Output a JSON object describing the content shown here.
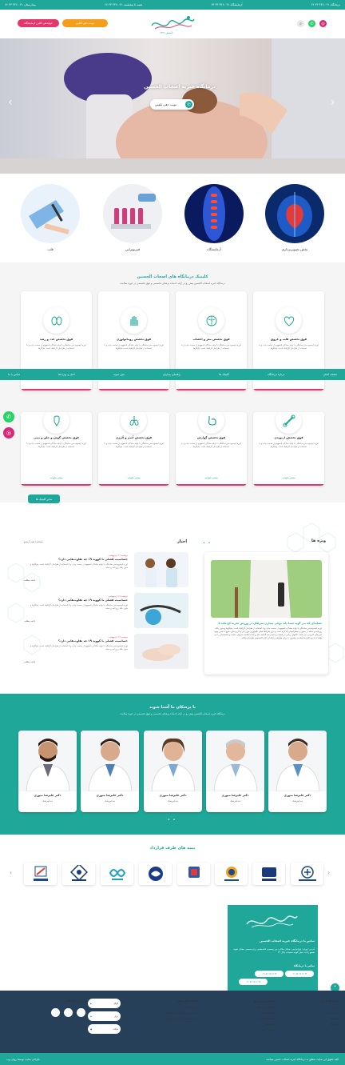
{
  "topbar": {
    "right": "درمانگاه ۰۲۱-۴۴۶ ۲۳ ۶۲",
    "center_right": "آزمایشگاه ۰۲۱-۴۴۶ ۲۳ ۶۳",
    "center_left": "شنبه تا پنجشنبه ۰۲۱-۴۴۶ ۲۳ ۶۶",
    "left": "بیمارستان ۰۲۱-۴۴۶ ۲۳ ۶۶"
  },
  "header": {
    "logo_text": "درمانگاه خیریه اصحاب الحسین",
    "logo_sub": "تأسیس ۱۳۹۱",
    "btn_nobat": "نوبت دهی آنلاین",
    "btn_javab": "جوابدهی آنلاین آزمایشگاه"
  },
  "hero": {
    "title": "درمانگاه خیریه اصحاب الحسین",
    "cta": "نوبت دهی تلفنی"
  },
  "categories": [
    {
      "label": "بخش تصویربرداری"
    },
    {
      "label": "آزمایشگاه"
    },
    {
      "label": "فیزیوتراپی"
    },
    {
      "label": "قلب"
    }
  ],
  "clinics": {
    "title": "کلینیک درمانگاه های اصحاب الحسین",
    "subtitle": "درمانگاه خیریه اصحاب الحسین پیش رو در ارائه خدمات پزشکی تخصصی و فوق تخصصی در حوزه سلامت",
    "desc": "لورم ایپسوم متن ساختگی با تولید سادگی نامفهوم از صنعت چاپ و با استفاده از طراحان گرافیک است. چاپگرها",
    "more": "بیشتر بخوانید",
    "all_button": "سایر کلینیک ها",
    "cards": [
      {
        "title": "فوق تخصص قلب و عروق"
      },
      {
        "title": "فوق تخصص مغز و اعصاب"
      },
      {
        "title": "فوق تخصص روماتولوژی"
      },
      {
        "title": "فوق تخصص غدد و رشد"
      },
      {
        "title": "فوق تخصص ارتوپدی"
      },
      {
        "title": "فوق تخصص گوارش"
      },
      {
        "title": "فوق تخصص آسم و آلرژی"
      },
      {
        "title": "فوق تخصص گوش و حلق و بینی"
      }
    ]
  },
  "nav": {
    "items": [
      "صفحه اصلی",
      "درباره درمانگاه",
      "کلینیک ها",
      "راهنمای بیماران",
      "متن نمونه",
      "اخبار و ویژه ها",
      "تماس با ما"
    ]
  },
  "specials": {
    "title": "ویژه ها",
    "item_title": "۵ نشانه‌ای که می گوید شما باید نوعی بیماری سرطان در ورزش تجربه کرده‌اید",
    "item_desc": "لورم ایپسوم متن ساختگی با تولید سادگی نامفهوم از صنعت چاپ و با استفاده از طراحان گرافیک است. چاپگرها و متون بلکه روزنامه و مجله در ستون و سطرآنچنان که لازم است و برای شرایط فعلی تکنولوژی مورد نیاز و کاربردهای متنوع با هدف بهبود ابزارهای کاربردی می باشد. کتابهای زیادی در شصت و سه درصد گذشته حال و آینده شناخت فراوان جامعه و متخصصان را می طلبد تا با نرم افزارها شناخت بیشتری را برای طراحان رایانه ای علی الخصوص طراحان خلاقی"
  },
  "news": {
    "title": "اخبار",
    "see_all": "مشاهده همه آرشیو",
    "more": "ادامه مطلب",
    "items": [
      {
        "date": "دوشنبه ۱۲ اردیبهشت",
        "title": "حساسیت فصلی با کووید ۱۹ چه تفاوت‌هایی دارد؟",
        "desc": "لورم ایپسوم متن ساختگی با تولید سادگی نامفهوم از صنعت چاپ و با استفاده از طراحان گرافیک است. چاپگرها و متون بلکه روزنامه و مجله"
      },
      {
        "date": "دوشنبه ۱۲ اردیبهشت",
        "title": "حساسیت فصلی با کووید ۱۹ چه تفاوت‌هایی دارد؟",
        "desc": "لورم ایپسوم متن ساختگی با تولید سادگی نامفهوم از صنعت چاپ و با استفاده از طراحان گرافیک است. چاپگرها و متون بلکه روزنامه و مجله"
      },
      {
        "date": "دوشنبه ۱۲ اردیبهشت",
        "title": "حساسیت فصلی با کووید ۱۹ چه تفاوت‌هایی دارد؟",
        "desc": "لورم ایپسوم متن ساختگی با تولید سادگی نامفهوم از صنعت چاپ و با استفاده از طراحان گرافیک است. چاپگرها و متون بلکه روزنامه و مجله"
      }
    ]
  },
  "doctors": {
    "title": "با پزشکان ما آشنا شوید",
    "subtitle": "درمانگاه خیریه اصحاب الحسین پیش رو در ارائه خدمات پزشکی تخصصی و فوق تخصصی در حوزه سلامت",
    "items": [
      {
        "name": "دکتر علیرضا منوری",
        "spec": "دندانپزشک"
      },
      {
        "name": "دکتر علیرضا منوری",
        "spec": "دندانپزشک"
      },
      {
        "name": "دکتر علیرضا منوری",
        "spec": "دندانپزشک"
      },
      {
        "name": "دکتر علیرضا منوری",
        "spec": "دندانپزشک"
      },
      {
        "name": "دکتر علیرضا منوری",
        "spec": "دندانپزشک"
      }
    ]
  },
  "insurance": {
    "title": "بیمه های طرف قرارداد",
    "items": [
      {
        "name": "سازمان بیمه سلامت ایران"
      },
      {
        "name": "بیمه ملت"
      },
      {
        "name": "بیمه سینا"
      },
      {
        "name": "بیمه رازی"
      },
      {
        "name": "بیمه تعاون"
      },
      {
        "name": "بیمه ما"
      },
      {
        "name": "تامین اجتماعی"
      },
      {
        "name": "بیمه آسیا"
      }
    ]
  },
  "contact": {
    "title": "تماس با درمانگاه خیریه اصحاب الحسین",
    "address": "آدرس: تهران، تهرانپارس، خیابان جلالی، بین ومعجزه فلسطینی و پارسیجعی خیابان شهید شفیع زادی، نبش کوچه سعیدی، پلاک ۲۴",
    "phones_label": "تماس با درمانگاه",
    "phone1": "۰۲۱-۷۷ ۶۷ ۶۶ ۴۴",
    "phone2": "۰۲۱-۷۷ ۶۷ ۶۶ ۴۴",
    "phone3": "۰۲۱-۷۷ ۶۷ ۶۶ ۴۴"
  },
  "footer": {
    "col1_title": "ارتباط با ما",
    "col1": [
      "درباره ما",
      "تماس با ما",
      "بیمه‌ها",
      "درمانگاه"
    ],
    "col2_title": "دسترسی سریع",
    "col2": [
      "کلینیک دندانپزشکی",
      "کلینیک تخصصی",
      "کلینیک فیزیوتراپی",
      "آزمایشگاه",
      "راهنمای بیماران"
    ],
    "col3_title": "لینک های مفید",
    "col3": [
      "فرم استخدام",
      "فرم ثبت پیشنهادات و انتقادات",
      "فرم نظرسنجی رضایت بیماران"
    ],
    "col4_title": "درمانگاه خیریه اصحاب حسین را دنبال کنید",
    "apps": [
      "گوگل",
      "بازار",
      "مایکت"
    ],
    "copyright": "کلیه حقوق این سایت متعلق به درمانگاه خیریه اصحاب حسین میباشد.",
    "designer": "طراحی سایت توسط رویان وب"
  },
  "colors": {
    "primary": "#1fa899",
    "accent": "#e5376b",
    "orange": "#f59e1c",
    "footer": "#27405a"
  }
}
